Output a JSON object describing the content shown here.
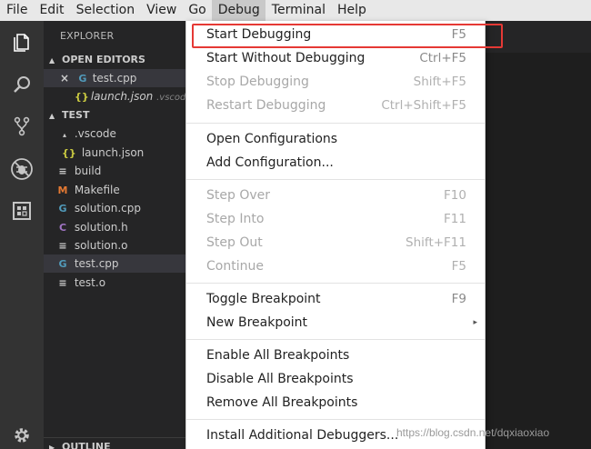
{
  "menubar": {
    "items": [
      "File",
      "Edit",
      "Selection",
      "View",
      "Go",
      "Debug",
      "Terminal",
      "Help"
    ]
  },
  "activity_bar": {
    "icons": [
      "files-icon",
      "search-icon",
      "source-control-icon",
      "debug-icon",
      "extensions-icon",
      "settings-gear-icon"
    ]
  },
  "sidebar": {
    "title": "EXPLORER",
    "open_editors_header": "OPEN EDITORS",
    "open_editors": [
      {
        "name": "test.cpp",
        "close": "×",
        "icon": "G"
      },
      {
        "name": "launch.json",
        "path": ".vscode",
        "icon": "{}"
      }
    ],
    "workspace_header": "TEST",
    "tree": [
      {
        "name": ".vscode",
        "icon": "▴"
      },
      {
        "name": "launch.json",
        "icon": "{}"
      },
      {
        "name": "build",
        "icon": "≡"
      },
      {
        "name": "Makefile",
        "icon": "M"
      },
      {
        "name": "solution.cpp",
        "icon": "G"
      },
      {
        "name": "solution.h",
        "icon": "C"
      },
      {
        "name": "solution.o",
        "icon": "≡"
      },
      {
        "name": "test.cpp",
        "icon": "G"
      },
      {
        "name": "test.o",
        "icon": "≡"
      }
    ],
    "outline_header": "OUTLINE"
  },
  "debug_menu": {
    "groups": [
      [
        {
          "label": "Start Debugging",
          "shortcut": "F5",
          "enabled": true
        },
        {
          "label": "Start Without Debugging",
          "shortcut": "Ctrl+F5",
          "enabled": true
        },
        {
          "label": "Stop Debugging",
          "shortcut": "Shift+F5",
          "enabled": false
        },
        {
          "label": "Restart Debugging",
          "shortcut": "Ctrl+Shift+F5",
          "enabled": false
        }
      ],
      [
        {
          "label": "Open Configurations",
          "shortcut": "",
          "enabled": true
        },
        {
          "label": "Add Configuration...",
          "shortcut": "",
          "enabled": true
        }
      ],
      [
        {
          "label": "Step Over",
          "shortcut": "F10",
          "enabled": false
        },
        {
          "label": "Step Into",
          "shortcut": "F11",
          "enabled": false
        },
        {
          "label": "Step Out",
          "shortcut": "Shift+F11",
          "enabled": false
        },
        {
          "label": "Continue",
          "shortcut": "F5",
          "enabled": false
        }
      ],
      [
        {
          "label": "Toggle Breakpoint",
          "shortcut": "F9",
          "enabled": true
        },
        {
          "label": "New Breakpoint",
          "shortcut": "",
          "enabled": true,
          "submenu": "▸"
        }
      ],
      [
        {
          "label": "Enable All Breakpoints",
          "shortcut": "",
          "enabled": true
        },
        {
          "label": "Disable All Breakpoints",
          "shortcut": "",
          "enabled": true
        },
        {
          "label": "Remove All Breakpoints",
          "shortcut": "",
          "enabled": true
        }
      ],
      [
        {
          "label": "Install Additional Debuggers...",
          "shortcut": "",
          "enabled": true
        }
      ]
    ]
  },
  "watermark": "https://blog.csdn.net/dqxiaoxiao",
  "colors": {
    "highlight_box": "#e53935",
    "menubar_bg": "#e8e8e8",
    "activity_bg": "#333333",
    "sidebar_bg": "#252526"
  }
}
